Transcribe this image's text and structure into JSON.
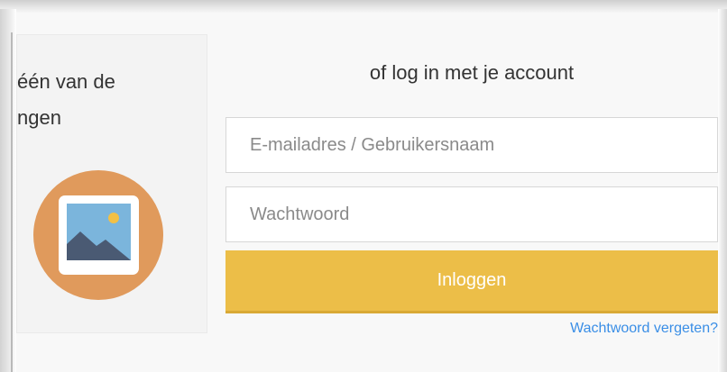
{
  "social_panel": {
    "text_line_1": "één van de",
    "text_line_2": "ngen",
    "icon": "image-placeholder-icon"
  },
  "login_form": {
    "title": "of log in met je account",
    "email_placeholder": "E-mailadres / Gebruikersnaam",
    "email_value": "",
    "password_placeholder": "Wachtwoord",
    "password_value": "",
    "submit_label": "Inloggen",
    "forgot_password_label": "Wachtwoord vergeten?"
  },
  "colors": {
    "accent_button": "#ecbe48",
    "link": "#3a8ee6",
    "icon_circle": "#e09a5c",
    "icon_sky": "#7bb5dc",
    "icon_mountain": "#4a5a73",
    "icon_sun": "#f2c045"
  }
}
